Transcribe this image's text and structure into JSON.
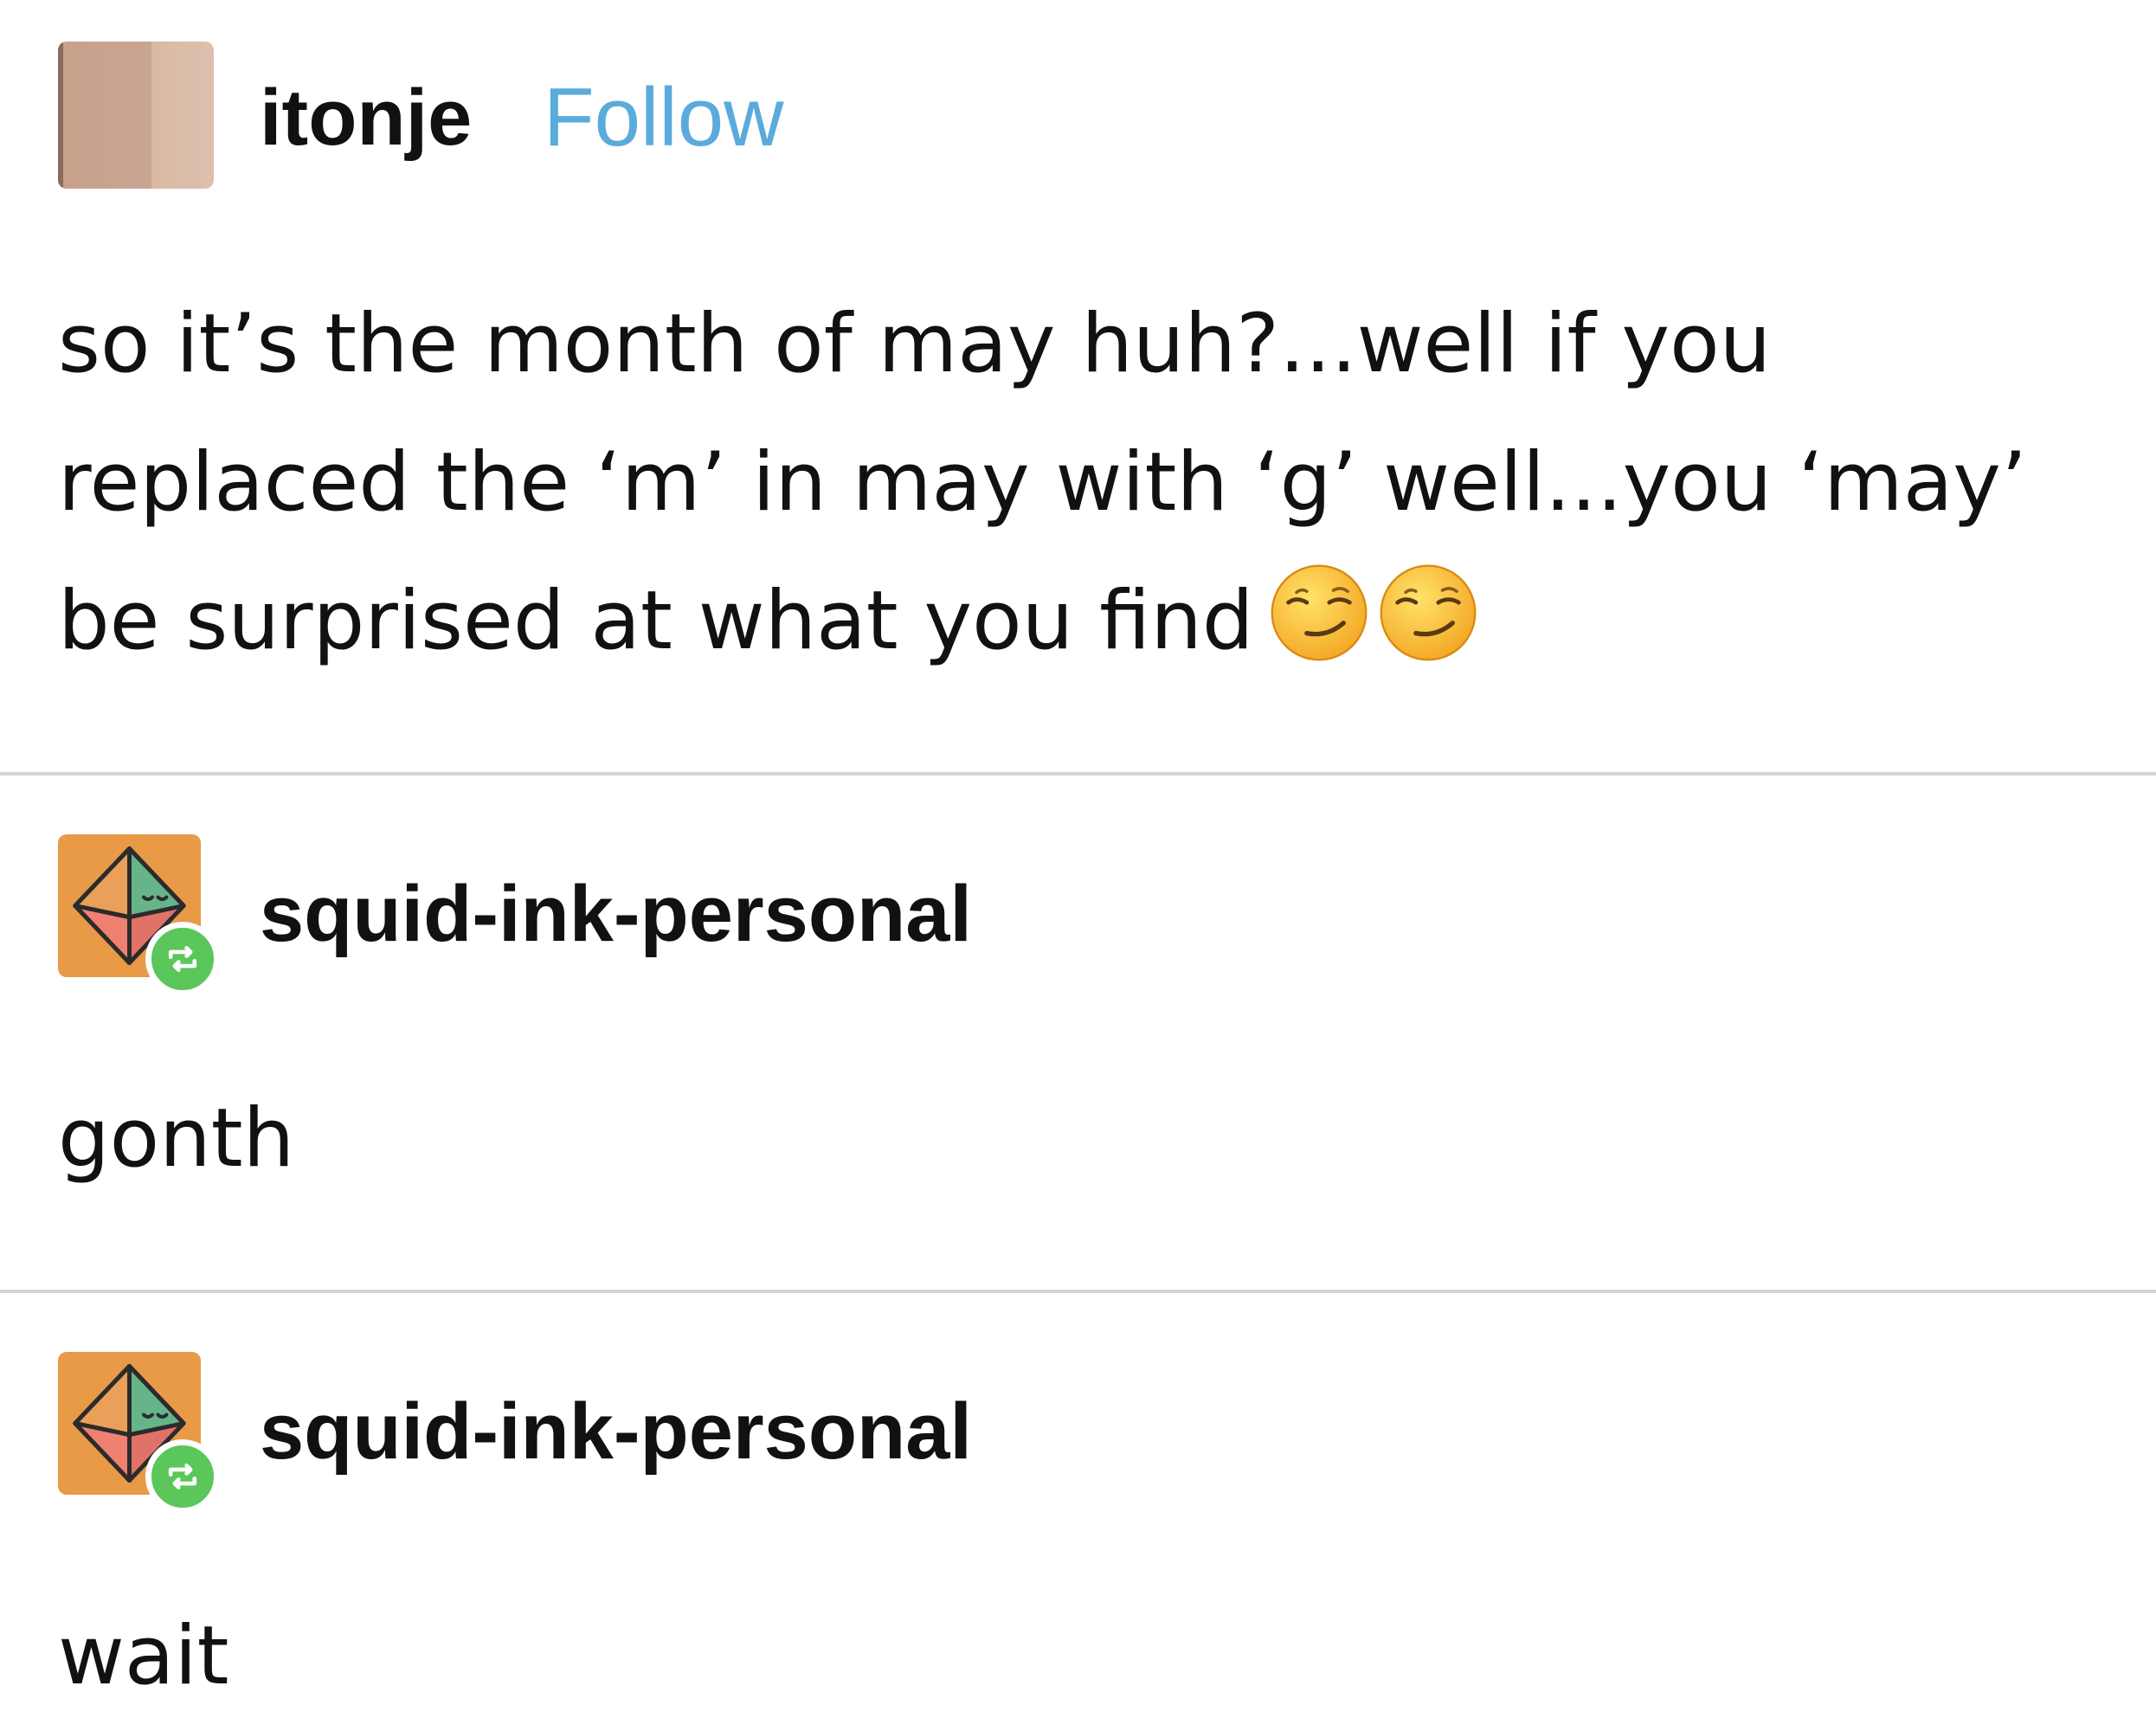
{
  "original_post": {
    "username": "itonje",
    "follow_label": "Follow",
    "lines": [
      "so it’s the month of may huh?...well if you",
      "replaced the ‘m’ in may with ‘g’ well...you ‘may’",
      "be surprised at what you find"
    ],
    "emoji_names": [
      "smirking-face-emoji",
      "smirking-face-emoji"
    ]
  },
  "reblogs": [
    {
      "username": "squid-ink-personal",
      "text": "gonth",
      "avatar_icon": "d20-dice-icon",
      "badge_icon": "reblog-icon"
    },
    {
      "username": "squid-ink-personal",
      "text": "wait",
      "avatar_icon": "d20-dice-icon",
      "badge_icon": "reblog-icon"
    }
  ],
  "colors": {
    "follow_link": "#5aabdc",
    "avatar_orange": "#e89a47",
    "reblog_badge": "#5bc65a",
    "divider": "#d4d4d4",
    "text": "#111111"
  }
}
